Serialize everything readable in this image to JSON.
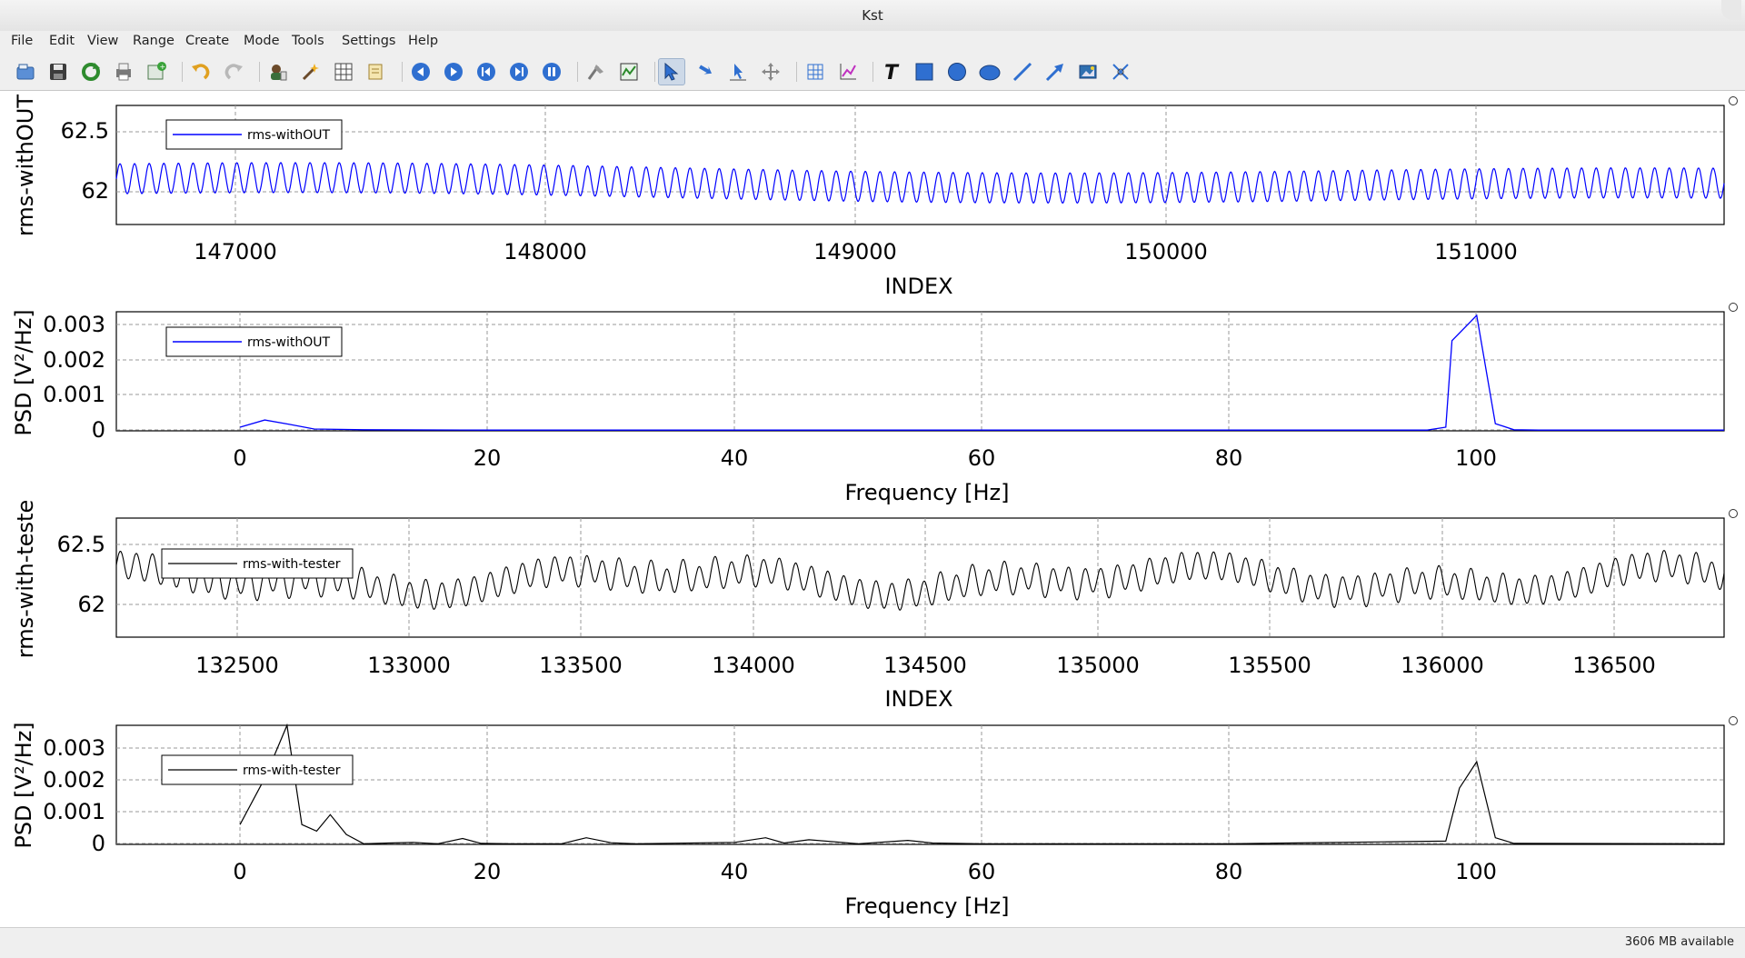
{
  "window": {
    "title": "Kst"
  },
  "menu": [
    "File",
    "Edit",
    "View",
    "Range",
    "Create",
    "Mode",
    "Tools",
    "Settings",
    "Help"
  ],
  "toolbar_icons": [
    "open-icon",
    "save-icon",
    "reload-icon",
    "print-icon",
    "export-icon",
    "undo-icon",
    "redo-icon",
    "data-manager-icon",
    "data-wizard-icon",
    "change-data-file-icon",
    "change-data-samples-icon",
    "back-icon",
    "forward-icon",
    "read-from-end-icon",
    "pause-icon",
    "stop-icon",
    "zoom-icon",
    "layout-icon",
    "zoom-mode-icon",
    "data-mode-icon",
    "layout-mode-icon",
    "move-icon",
    "plot-icon",
    "curve-icon",
    "text-icon",
    "box-icon",
    "circle-icon",
    "ellipse-icon",
    "line-icon",
    "arrow-icon",
    "picture-icon",
    "shared-axis-icon"
  ],
  "status": {
    "memory": "3606 MB available"
  },
  "colors": {
    "blue": "#0000ff",
    "black": "#000000"
  },
  "plots": [
    {
      "ylabel": "rms-withOUT",
      "xlabel": "INDEX",
      "legend": "rms-withOUT",
      "yticks": [
        "62.5",
        "62"
      ],
      "xticks": [
        "147000",
        "148000",
        "149000",
        "150000",
        "151000"
      ]
    },
    {
      "ylabel": "PSD [V²/Hz]",
      "xlabel": "Frequency [Hz]",
      "legend": "rms-withOUT",
      "yticks": [
        "0.003",
        "0.002",
        "0.001",
        "0"
      ],
      "xticks": [
        "0",
        "20",
        "40",
        "60",
        "80",
        "100"
      ]
    },
    {
      "ylabel": "rms-with-teste",
      "xlabel": "INDEX",
      "legend": "rms-with-tester",
      "yticks": [
        "62.5",
        "62"
      ],
      "xticks": [
        "132500",
        "133000",
        "133500",
        "134000",
        "134500",
        "135000",
        "135500",
        "136000",
        "136500"
      ]
    },
    {
      "ylabel": "PSD [V²/Hz]",
      "xlabel": "Frequency [Hz]",
      "legend": "rms-with-tester",
      "yticks": [
        "0.003",
        "0.002",
        "0.001",
        "0"
      ],
      "xticks": [
        "0",
        "20",
        "40",
        "60",
        "80",
        "100"
      ]
    }
  ],
  "chart_data": [
    {
      "type": "line",
      "series": [
        {
          "name": "rms-withOUT",
          "color": "#0000ff",
          "description_values": {
            "mean": 62.1,
            "amplitude": 0.12,
            "cycles": 110
          }
        }
      ],
      "xlim": [
        146630,
        151800
      ],
      "ylim": [
        61.75,
        62.7
      ],
      "grid": true,
      "legend": "top-left"
    },
    {
      "type": "line",
      "series": [
        {
          "name": "rms-withOUT",
          "color": "#0000ff",
          "x": [
            0,
            2,
            4,
            6,
            10,
            20,
            40,
            60,
            80,
            96,
            97.5,
            98,
            100,
            101.5,
            103,
            105,
            120
          ],
          "y": [
            0.0001,
            0.0003,
            0.00018,
            5e-05,
            3e-05,
            2e-05,
            2e-05,
            2e-05,
            2e-05,
            2e-05,
            0.0001,
            0.0025,
            0.0032,
            0.0002,
            3e-05,
            2e-05,
            2e-05
          ]
        }
      ],
      "xlim": [
        -10,
        120
      ],
      "ylim": [
        0,
        0.0033
      ],
      "grid": true,
      "legend": "top-left"
    },
    {
      "type": "line",
      "series": [
        {
          "name": "rms-with-tester",
          "color": "#000000",
          "description_values": {
            "mean": 62.15,
            "amplitude": 0.12,
            "cycles": 100
          }
        }
      ],
      "xlim": [
        132150,
        136830
      ],
      "ylim": [
        61.65,
        62.7
      ],
      "grid": true,
      "legend": "top-left"
    },
    {
      "type": "line",
      "series": [
        {
          "name": "rms-with-tester",
          "color": "#000000",
          "x": [
            0,
            2,
            3.8,
            5,
            6.2,
            7.3,
            8.6,
            10,
            12,
            14,
            16,
            18,
            19.5,
            22,
            26,
            28,
            30,
            32,
            40,
            42.5,
            44,
            46,
            50,
            54,
            56,
            60,
            80,
            97.5,
            98.6,
            100,
            101.5,
            103,
            120
          ],
          "y": [
            0.0006,
            0.002,
            0.0036,
            0.0006,
            0.0004,
            0.0009,
            0.0003,
            2e-05,
            4e-05,
            6e-05,
            2e-05,
            0.00018,
            3e-05,
            2e-05,
            2e-05,
            0.0002,
            5e-05,
            2e-05,
            6e-05,
            0.0002,
            4e-05,
            0.00014,
            2e-05,
            0.00012,
            4e-05,
            2e-05,
            2e-05,
            0.0001,
            0.0017,
            0.0025,
            0.0002,
            3e-05,
            2e-05
          ]
        }
      ],
      "xlim": [
        -10,
        120
      ],
      "ylim": [
        0,
        0.0036
      ],
      "grid": true,
      "legend": "top-left"
    }
  ]
}
